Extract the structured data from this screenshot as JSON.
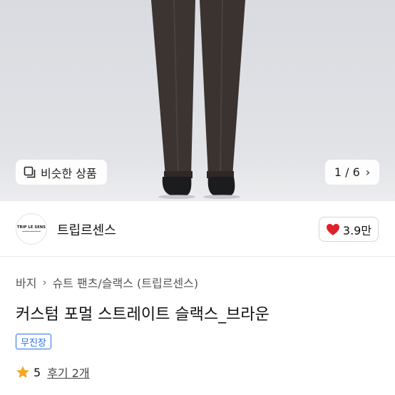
{
  "hero": {
    "similar_button_label": "비슷한 상품",
    "image_counter": "1 / 6",
    "colors": {
      "background": "#dcdee2",
      "trousers": "#3b3431",
      "shoes": "#1c1c1e"
    }
  },
  "brand": {
    "logo_text": "TRIP LE SENS",
    "name": "트립르센스",
    "like_count": "3.9만",
    "heart_color": "#e0202e"
  },
  "breadcrumb": {
    "items": [
      "바지",
      "슈트 팬츠/슬랙스 (트립르센스)"
    ]
  },
  "product": {
    "title": "커스텀 포멀 스트레이트 슬랙스_브라운",
    "badge": "무진장",
    "badge_color": "#2b6fe6",
    "rating_score": "5",
    "review_link": "후기 2개",
    "star_color": "#f5a623"
  }
}
